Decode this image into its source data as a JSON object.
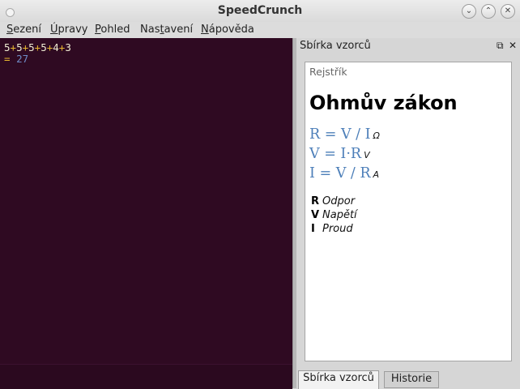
{
  "window": {
    "title": "SpeedCrunch"
  },
  "menubar": {
    "items": [
      {
        "u": "S",
        "rest": "ezení"
      },
      {
        "u": "Ú",
        "rest": "pravy"
      },
      {
        "u": "P",
        "rest": "ohled"
      },
      {
        "pre": "Nas",
        "u": "t",
        "rest": "avení"
      },
      {
        "u": "N",
        "rest": "ápověda"
      }
    ]
  },
  "editor": {
    "expression": [
      "5",
      "+",
      "5",
      "+",
      "5",
      "+",
      "5",
      "+",
      "4",
      "+",
      "3"
    ],
    "result_prefix": "=",
    "result_value": "27"
  },
  "dock": {
    "title": "Sbírka vzorců",
    "float_icon": "⧉",
    "close_icon": "✕",
    "breadcrumb": "Rejstřík",
    "heading": "Ohmův zákon",
    "formulas": [
      {
        "text": "R = V / I",
        "unit": "Ω"
      },
      {
        "text": "V = I·R",
        "unit": "V"
      },
      {
        "text": "I = V / R",
        "unit": "A"
      }
    ],
    "legend": [
      {
        "symbol": "R",
        "name": "Odpor"
      },
      {
        "symbol": "V",
        "name": "Napětí"
      },
      {
        "symbol": "I",
        "name": "Proud"
      }
    ],
    "tabs": [
      "Sbírka vzorců",
      "Historie"
    ]
  },
  "icons": {
    "minimize": "⌄",
    "maximize": "⌃",
    "close": "✕"
  }
}
